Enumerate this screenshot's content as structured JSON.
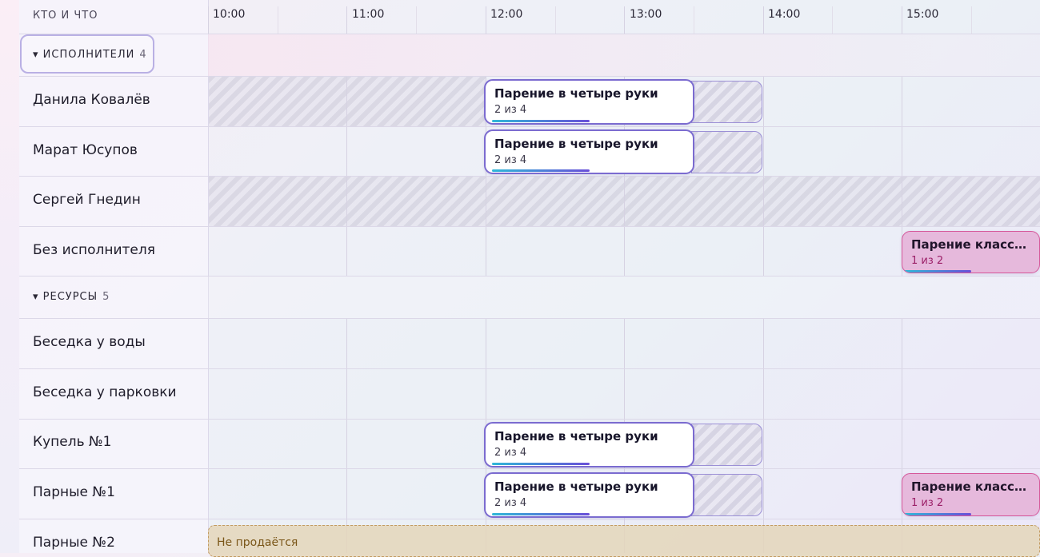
{
  "header": {
    "column_title": "КТО И ЧТО"
  },
  "timeline": {
    "hours": [
      "10:00",
      "11:00",
      "12:00",
      "13:00",
      "14:00",
      "15:00"
    ]
  },
  "groups": {
    "performers": {
      "label": "▾ ИСПОЛНИТЕЛИ",
      "count": "4"
    },
    "resources": {
      "label": "▾ РЕСУРСЫ",
      "count": "5"
    }
  },
  "rows": {
    "r1": "Данила Ковалёв",
    "r2": "Марат Юсупов",
    "r3": "Сергей Гнедин",
    "r4": "Без исполнителя",
    "r5": "Беседка у воды",
    "r6": "Беседка у парковки",
    "r7": "Купель №1",
    "r8": "Парные №1",
    "r9": "Парные №2"
  },
  "events": {
    "e1": {
      "title": "Парение в четыре руки",
      "capacity": "2 из 4"
    },
    "e2": {
      "title": "Парение в четыре руки",
      "capacity": "2 из 4"
    },
    "e3": {
      "title": "Парение класси…",
      "capacity": "1 из 2"
    },
    "e4": {
      "title": "Парение в четыре руки",
      "capacity": "2 из 4"
    },
    "e5": {
      "title": "Парение в четыре руки",
      "capacity": "2 из 4"
    },
    "e6": {
      "title": "Парение класси…",
      "capacity": "1 из 2"
    }
  },
  "not_for_sale": "Не продаётся",
  "colors": {
    "accent": "#7b6bd0",
    "event_pink": "#e6b9dc",
    "not_for_sale_bg": "#e4d6ba",
    "progress_from": "#2fb8d8",
    "progress_to": "#6a4fd8"
  }
}
